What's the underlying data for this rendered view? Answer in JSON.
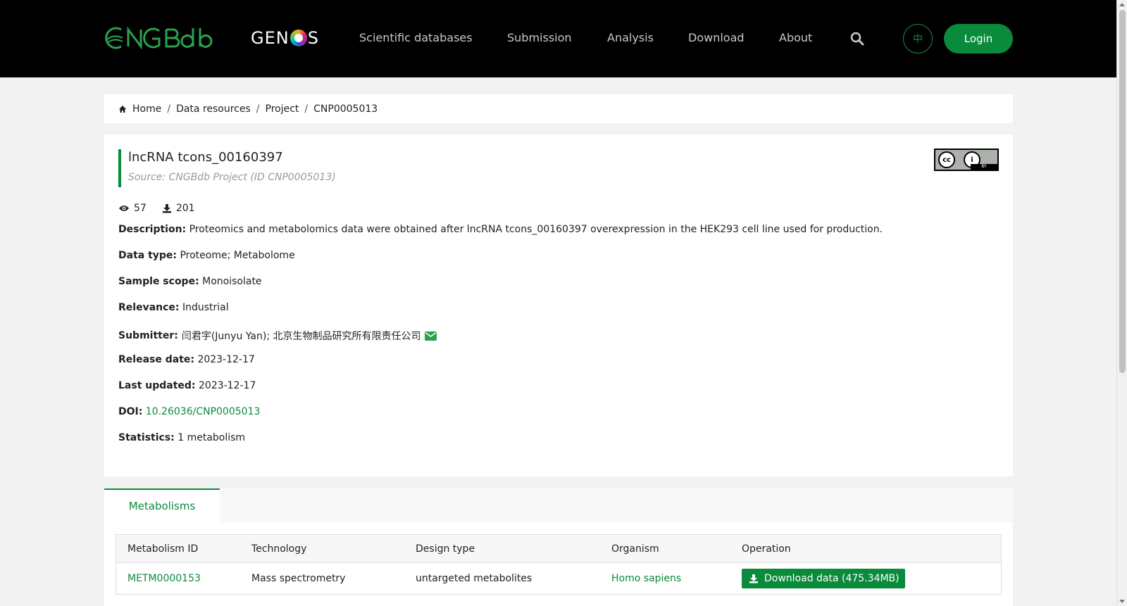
{
  "header": {
    "logo_cngb": "CNGBdb",
    "logo_genos_pre": "GEN",
    "logo_genos_post": "S",
    "nav": [
      "Scientific databases",
      "Submission",
      "Analysis",
      "Download",
      "About"
    ],
    "lang_label": "中",
    "login_label": "Login"
  },
  "breadcrumb": [
    "Home",
    "Data resources",
    "Project",
    "CNP0005013"
  ],
  "project": {
    "title": "lncRNA tcons_00160397",
    "source": "Source: CNGBdb Project (ID CNP0005013)",
    "license_badge": "BY",
    "views": "57",
    "downloads": "201",
    "fields": {
      "description_label": "Description:",
      "description": "Proteomics and metabolomics data were obtained after lncRNA tcons_00160397 overexpression in the HEK293 cell line used for production.",
      "data_type_label": "Data type:",
      "data_type": "Proteome; Metabolome",
      "sample_scope_label": "Sample scope:",
      "sample_scope": "Monoisolate",
      "relevance_label": "Relevance:",
      "relevance": "Industrial",
      "submitter_label": "Submitter:",
      "submitter": "闫君宇(Junyu Yan); 北京生物制品研究所有限责任公司",
      "release_date_label": "Release date:",
      "release_date": "2023-12-17",
      "last_updated_label": "Last updated:",
      "last_updated": "2023-12-17",
      "doi_label": "DOI:",
      "doi": "10.26036/CNP0005013",
      "statistics_label": "Statistics:",
      "statistics": "1 metabolism"
    }
  },
  "tabs": {
    "active": "Metabolisms"
  },
  "table": {
    "headers": [
      "Metabolism ID",
      "Technology",
      "Design type",
      "Organism",
      "Operation"
    ],
    "rows": [
      {
        "id": "METM0000153",
        "technology": "Mass spectrometry",
        "design_type": "untargeted metabolites",
        "organism": "Homo sapiens",
        "operation": "Download data (475.34MB)"
      }
    ]
  },
  "colors": {
    "accent": "#0a8a3b",
    "header_bg": "#000000"
  }
}
